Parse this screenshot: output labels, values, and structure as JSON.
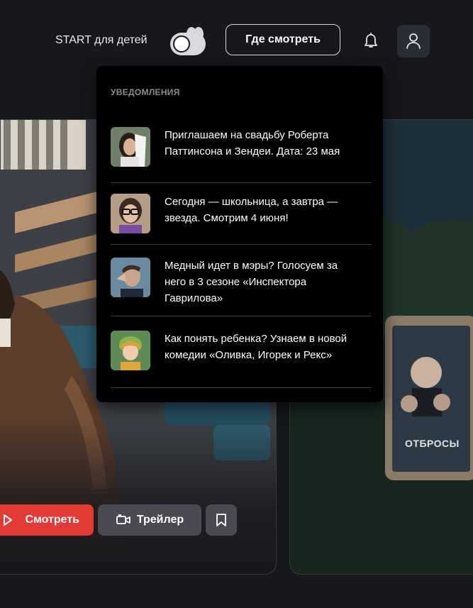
{
  "header": {
    "kids_label": "START для детей",
    "where_to_watch": "Где смотреть",
    "icons": {
      "kids_toggle": "bunny-toggle-icon",
      "notifications": "bell-icon",
      "profile": "user-icon"
    }
  },
  "notifications": {
    "title": "УВЕДОМЛЕНИЯ",
    "items": [
      {
        "text": "Приглашаем на свадьбу Роберта Паттинсона и Зендеи. Дата: 23 мая"
      },
      {
        "text": "Сегодня — школьница, а завтра — звезда. Смотрим 4 июня!"
      },
      {
        "text": "Медный идет в мэры? Голосуем за него в 3 сезоне «Инспектора Гаврилова»"
      },
      {
        "text": "Как понять ребенка? Узнаем в новой комедии «Оливка, Игорек и Рекс»"
      }
    ]
  },
  "hero": {
    "watch_label": "Смотреть",
    "trailer_label": "Трейлер",
    "icons": {
      "watch": "play-icon",
      "trailer": "camera-icon",
      "bookmark": "bookmark-icon"
    }
  },
  "side_card": {
    "poster_title": "ОТБРОСЫ"
  },
  "colors": {
    "background": "#17181c",
    "accent_red": "#e53935",
    "panel": "#000000",
    "button_gray": "#4a4b52"
  }
}
